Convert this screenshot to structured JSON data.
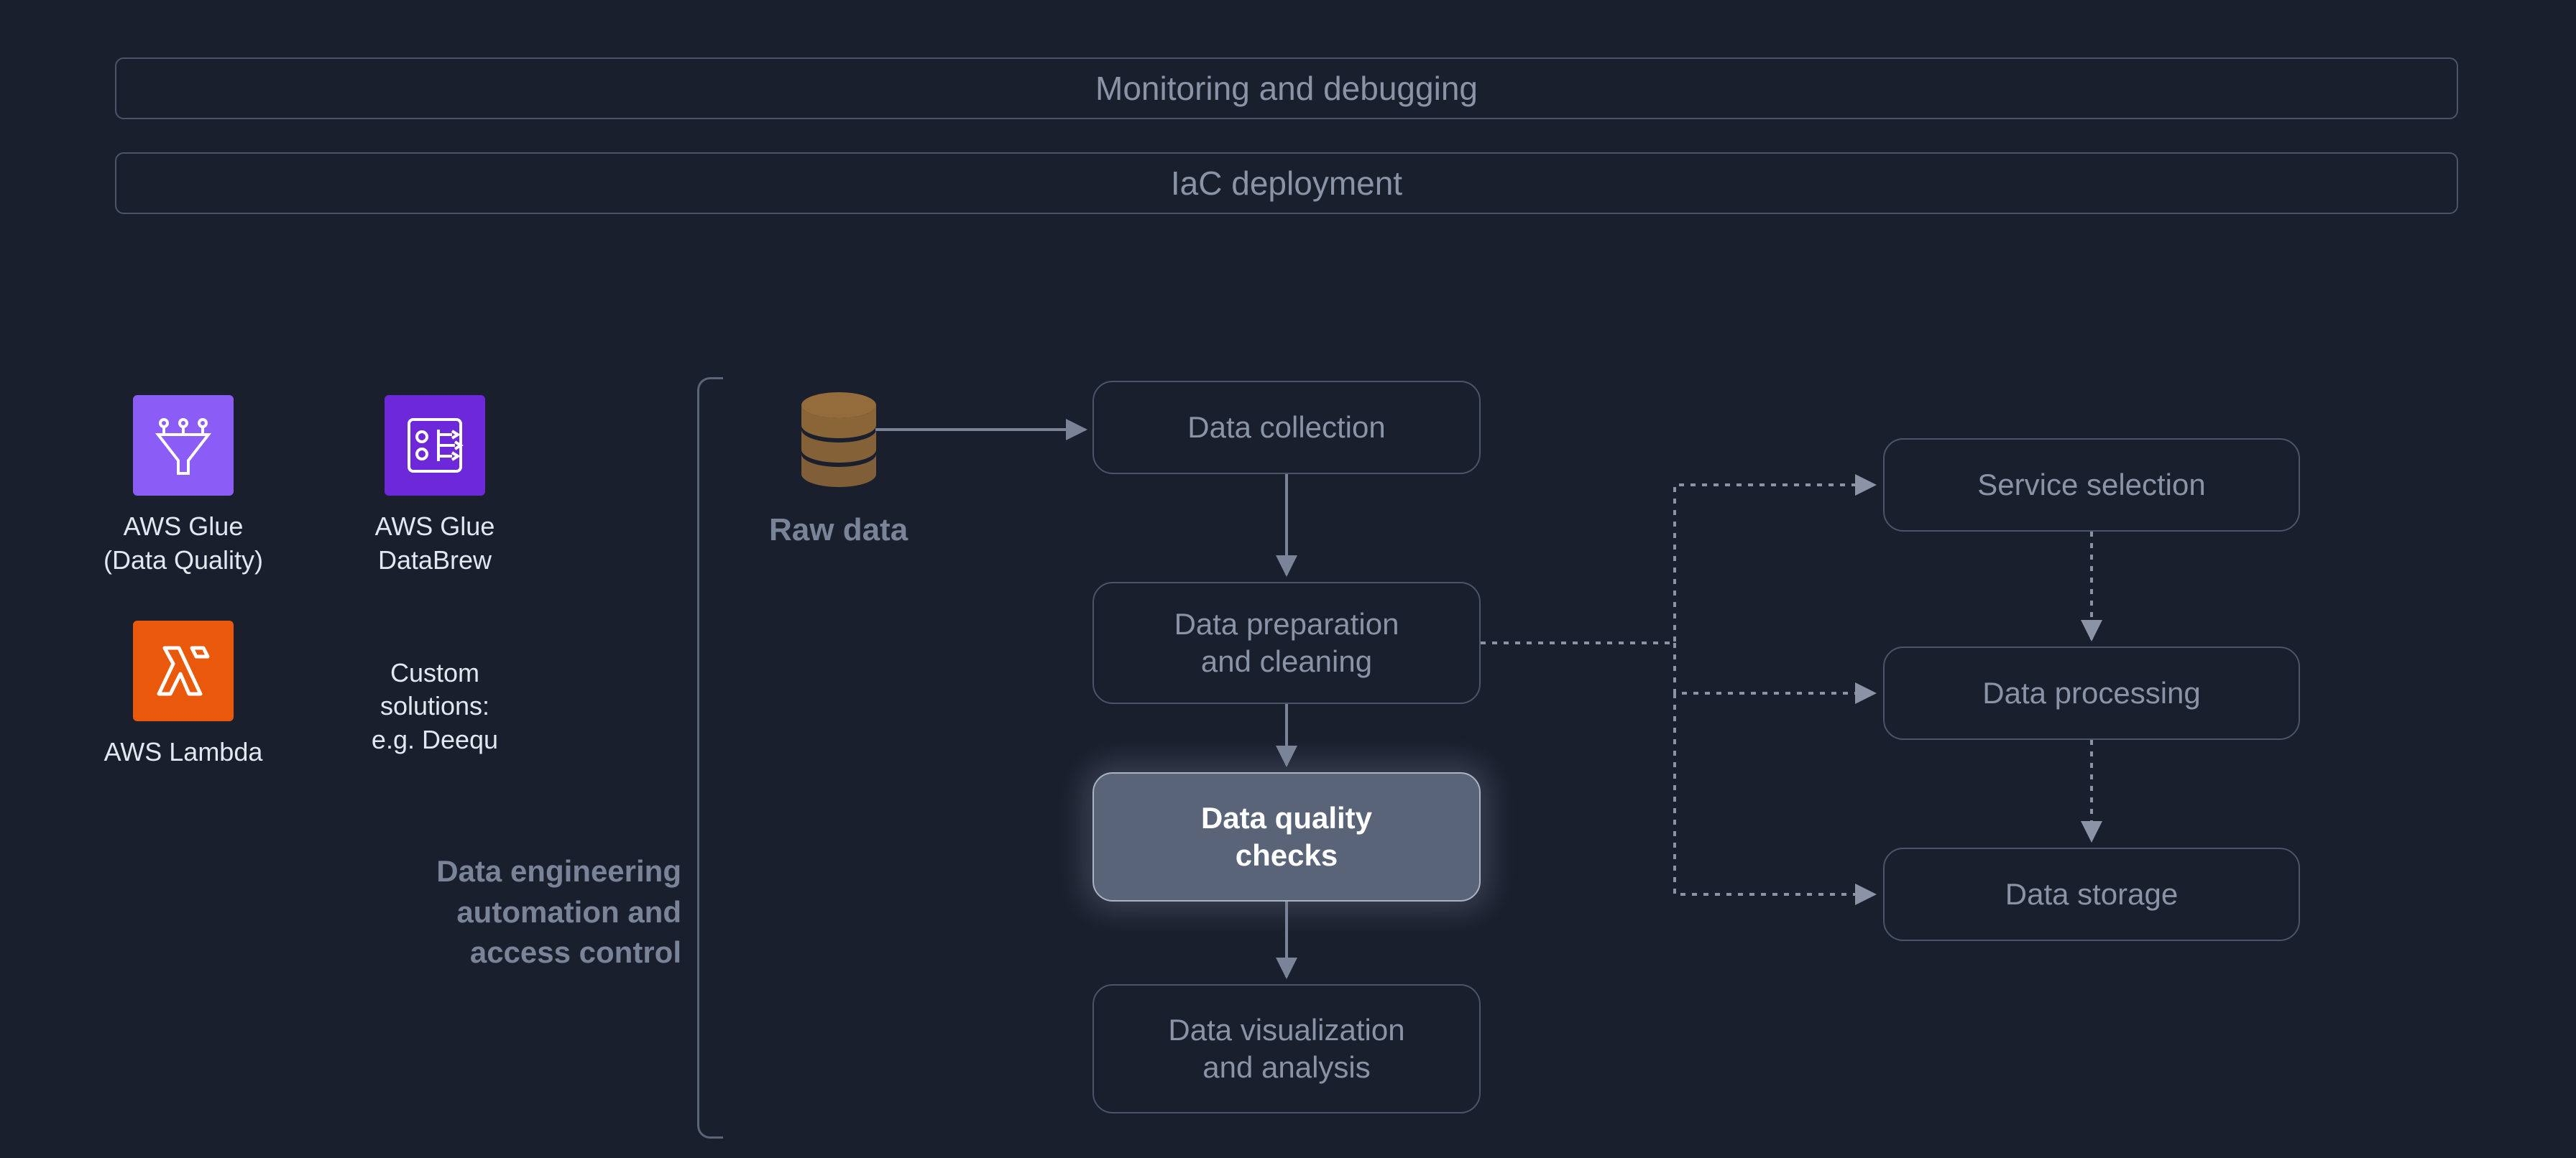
{
  "banners": {
    "top": "Monitoring and debugging",
    "bottom": "IaC deployment"
  },
  "services": {
    "glue_dq": {
      "label": "AWS Glue\n(Data Quality)"
    },
    "glue_databrew": {
      "label": "AWS Glue\nDataBrew"
    },
    "lambda": {
      "label": "AWS Lambda"
    },
    "custom": {
      "label": "Custom\nsolutions:\ne.g. Deequ"
    }
  },
  "labels": {
    "raw_data": "Raw data",
    "automation": "Data engineering\nautomation and\naccess control"
  },
  "nodes": {
    "data_collection": "Data collection",
    "data_prep": "Data preparation\nand cleaning",
    "data_quality": "Data quality\nchecks",
    "data_viz": "Data visualization\nand analysis",
    "service_selection": "Service selection",
    "data_processing": "Data processing",
    "data_storage": "Data storage"
  },
  "colors": {
    "bg": "#1a1f2e",
    "border": "#4a5568",
    "text_dim": "#8a94a6",
    "text_light": "#e2e8f0",
    "highlight_bg": "#5a6478",
    "db_icon": "#946b3a"
  }
}
